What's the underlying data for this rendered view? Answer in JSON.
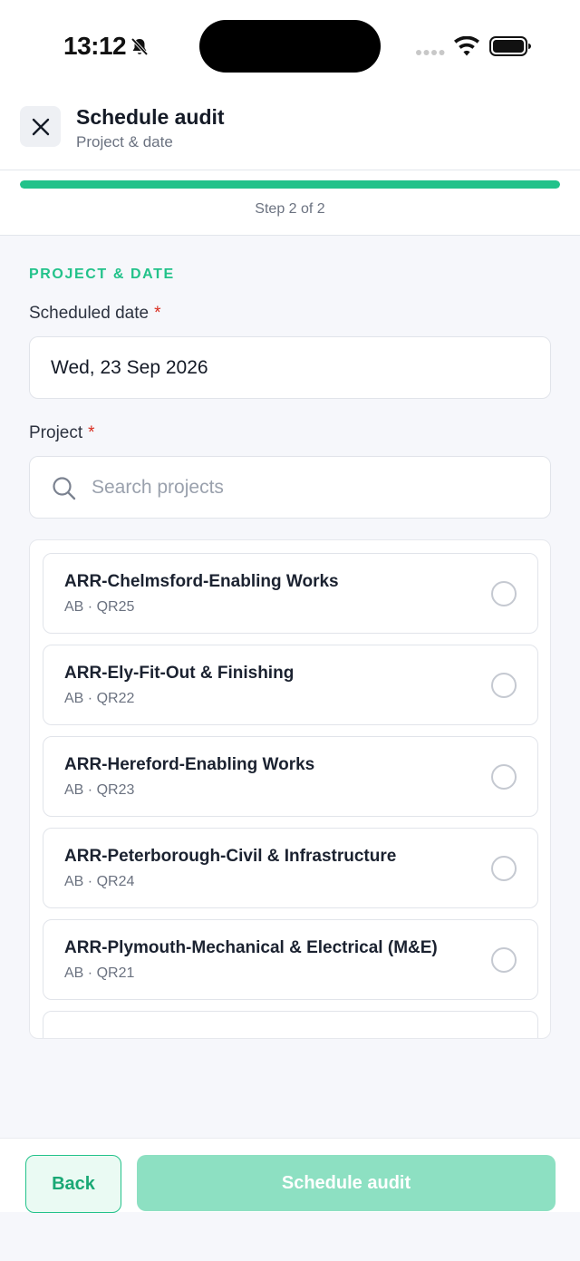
{
  "status_bar": {
    "time": "13:12",
    "icons": [
      "bell-slash-icon",
      "signal-icon",
      "wifi-icon",
      "battery-icon"
    ]
  },
  "header": {
    "close_icon": "close-icon",
    "title": "Schedule audit",
    "subtitle": "Project & date"
  },
  "progress": {
    "step_text": "Step 2 of 2",
    "fraction": 1.0
  },
  "form": {
    "section_title": "PROJECT & DATE",
    "date_label": "Scheduled date",
    "date_value": "Wed, 23 Sep 2026",
    "project_label": "Project",
    "required_mark": "*",
    "search_placeholder": "Search projects",
    "search_value": ""
  },
  "projects": [
    {
      "name": "ARR-Chelmsford-Enabling Works",
      "meta": "AB · QR25",
      "selected": false
    },
    {
      "name": "ARR-Ely-Fit-Out & Finishing",
      "meta": "AB · QR22",
      "selected": false
    },
    {
      "name": "ARR-Hereford-Enabling Works",
      "meta": "AB · QR23",
      "selected": false
    },
    {
      "name": "ARR-Peterborough-Civil & Infrastructure",
      "meta": "AB · QR24",
      "selected": false
    },
    {
      "name": "ARR-Plymouth-Mechanical & Electrical (M&E)",
      "meta": "AB · QR21",
      "selected": false
    }
  ],
  "footer": {
    "back_label": "Back",
    "submit_label": "Schedule audit"
  },
  "colors": {
    "accent": "#22c28a",
    "accent_disabled": "#8de0c2",
    "required": "#d92d20",
    "background": "#f6f7fb"
  }
}
